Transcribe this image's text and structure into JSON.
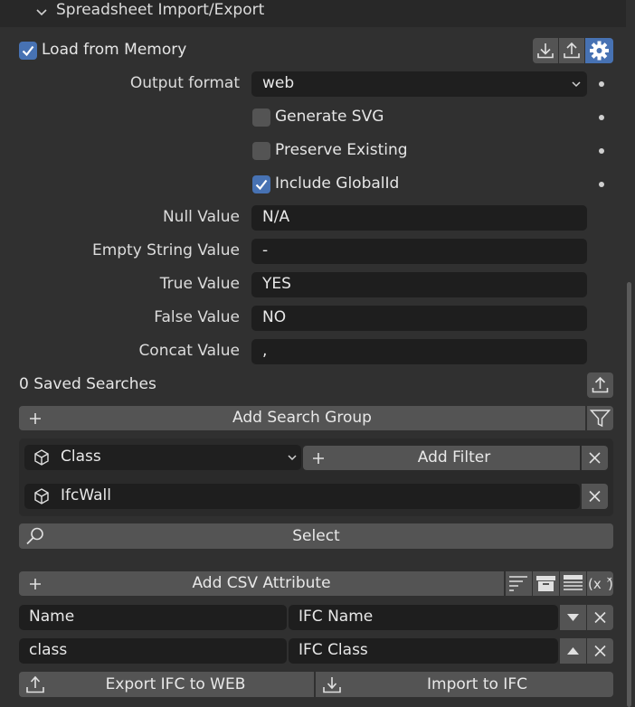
{
  "panel": {
    "title": "Spreadsheet Import/Export"
  },
  "load_from_memory": {
    "label": "Load from Memory",
    "checked": true
  },
  "header_icons": [
    "download-icon",
    "upload-icon",
    "gear-icon"
  ],
  "output_format": {
    "label": "Output format",
    "value": "web"
  },
  "options": [
    {
      "label": "Generate SVG",
      "checked": false
    },
    {
      "label": "Preserve Existing",
      "checked": false
    },
    {
      "label": "Include GlobalId",
      "checked": true
    }
  ],
  "values": [
    {
      "label": "Null Value",
      "value": "N/A"
    },
    {
      "label": "Empty String Value",
      "value": "-"
    },
    {
      "label": "True Value",
      "value": "YES"
    },
    {
      "label": "False Value",
      "value": "NO"
    },
    {
      "label": "Concat Value",
      "value": ","
    }
  ],
  "saved_searches": {
    "label": "0 Saved Searches"
  },
  "search": {
    "add_group_label": "Add Search Group",
    "filter_type": "Class",
    "add_filter_label": "Add Filter",
    "filter_value": "IfcWall",
    "select_label": "Select"
  },
  "csv": {
    "add_attribute_label": "Add CSV Attribute",
    "attributes": [
      {
        "name": "Name",
        "ifc": "IFC Name"
      },
      {
        "name": "class",
        "ifc": "IFC Class"
      }
    ]
  },
  "footer": {
    "export_label": "Export IFC to WEB",
    "import_label": "Import to IFC"
  },
  "colors": {
    "accent": "#4772b3",
    "panel_bg": "#303030",
    "field_bg": "#1e1e1e",
    "button_bg": "#545454"
  }
}
